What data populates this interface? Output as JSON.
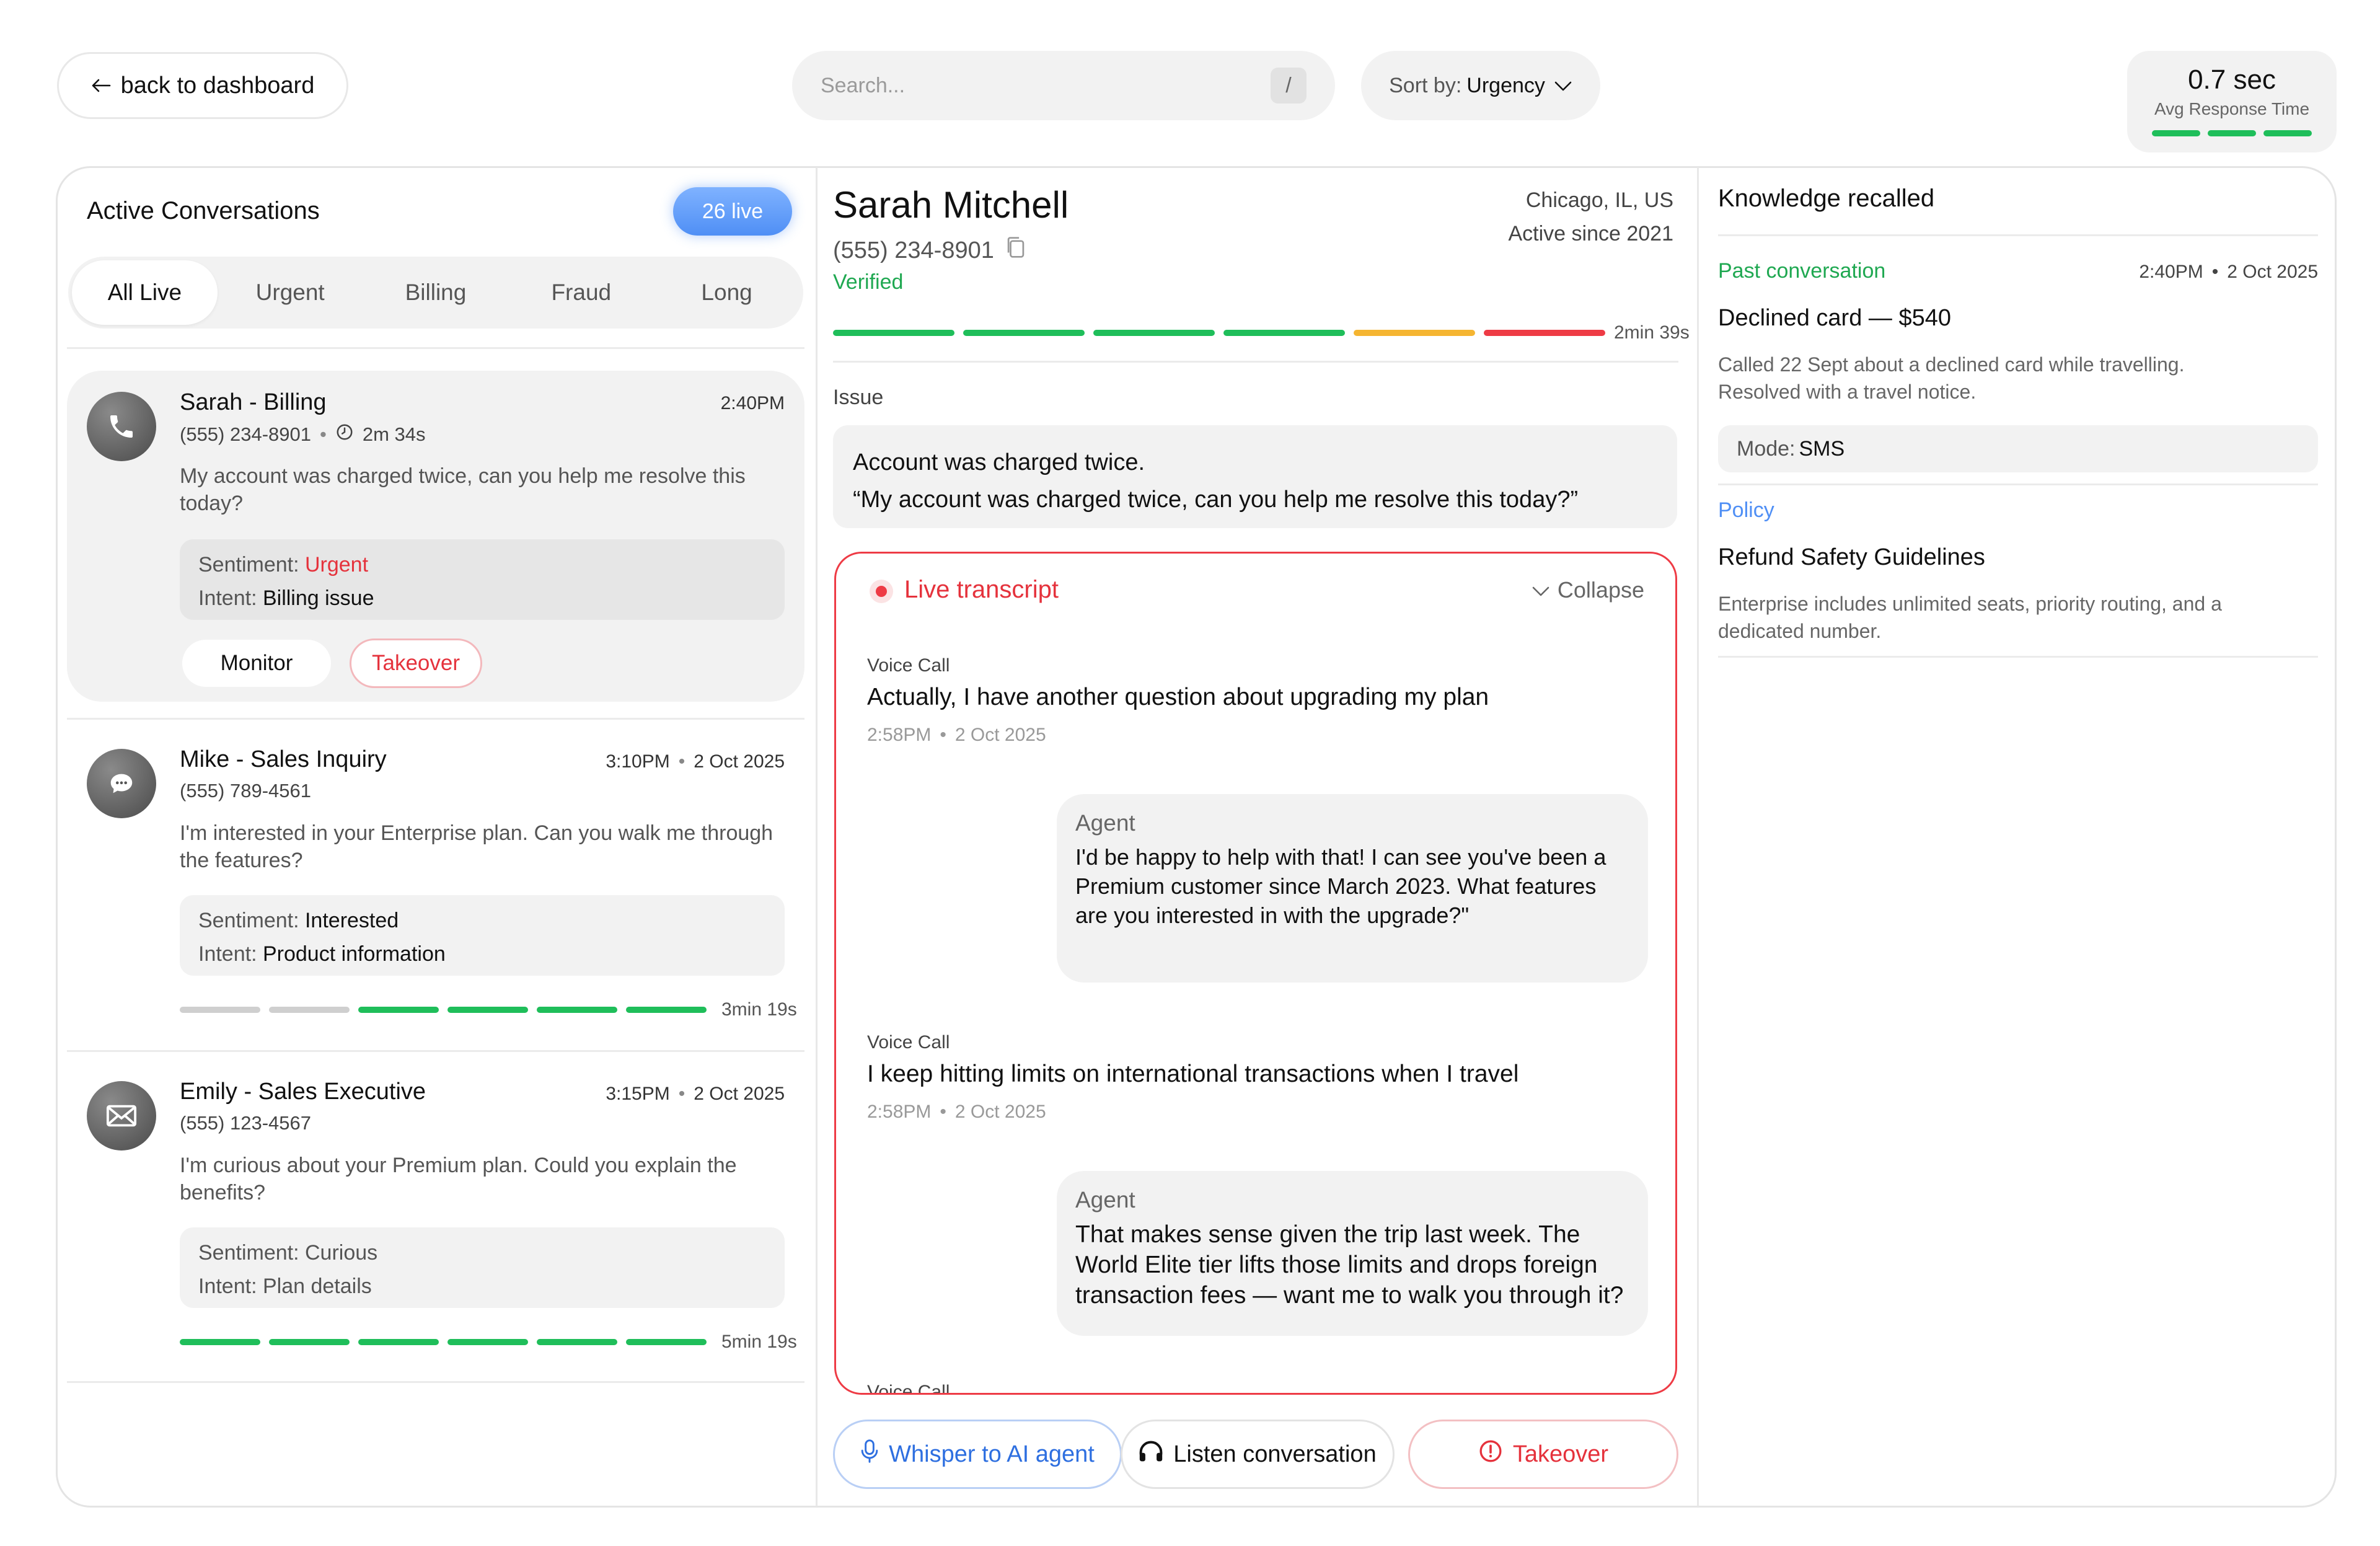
{
  "topbar": {
    "back_label": "back to dashboard",
    "search_placeholder": "Search...",
    "search_shortcut": "/",
    "sort_prefix": "Sort by:",
    "sort_value": "Urgency",
    "avg_response_value": "0.7 sec",
    "avg_response_label": "Avg Response Time"
  },
  "conversations": {
    "title": "Active Conversations",
    "live_count": "26 live",
    "tabs": [
      "All Live",
      "Urgent",
      "Billing",
      "Fraud",
      "Long"
    ],
    "active_tab": "All Live",
    "items": [
      {
        "name": "Sarah - Billing",
        "time": "2:40PM",
        "phone": "(555) 234-8901",
        "duration": "2m 34s",
        "message": "My account was charged twice, can you help me resolve this today?",
        "sentiment_label": "Sentiment:",
        "sentiment": "Urgent",
        "intent_label": "Intent:",
        "intent": "Billing issue",
        "monitor_label": "Monitor",
        "takeover_label": "Takeover",
        "channel_icon": "phone-icon"
      },
      {
        "name": "Mike - Sales Inquiry",
        "time": "3:10PM",
        "date": "2 Oct 2025",
        "phone": "(555) 789-4561",
        "message": "I'm interested in your Enterprise plan. Can you walk me through the features?",
        "sentiment_label": "Sentiment:",
        "sentiment": "Interested",
        "intent_label": "Intent:",
        "intent": "Product information",
        "elapsed": "3min 19s",
        "progress_segments": [
          "gray",
          "gray",
          "green",
          "green",
          "green",
          "green"
        ],
        "channel_icon": "chat-icon"
      },
      {
        "name": "Emily - Sales Executive",
        "time": "3:15PM",
        "date": "2 Oct 2025",
        "phone": "(555) 123-4567",
        "message": "I'm curious about your Premium plan. Could you explain the benefits?",
        "sentiment_label": "Sentiment:",
        "sentiment": "Curious",
        "intent_label": "Intent:",
        "intent": "Plan details",
        "elapsed": "5min 19s",
        "progress_segments": [
          "green",
          "green",
          "green",
          "green",
          "green",
          "green"
        ],
        "channel_icon": "mail-icon"
      }
    ]
  },
  "detail": {
    "name": "Sarah Mitchell",
    "phone": "(555) 234-8901",
    "verified": "Verified",
    "location": "Chicago, IL, US",
    "active_since": "Active since 2021",
    "elapsed": "2min 39s",
    "progress_segments": [
      "green",
      "green",
      "green",
      "green",
      "yellow",
      "red"
    ],
    "issue_label": "Issue",
    "issue_summary": "Account was charged twice.",
    "issue_quote": "“My account was charged twice, can you help me resolve this today?”",
    "transcript": {
      "title": "Live transcript",
      "collapse_label": "Collapse",
      "entries": [
        {
          "channel": "Voice Call",
          "message": "Actually, I have another question about upgrading my plan",
          "time": "2:58PM",
          "date": "2 Oct 2025"
        },
        {
          "agent_label": "Agent",
          "agent_text": "I'd be happy to help with that! I can see you've been a Premium customer since March 2023. What features are you interested in with the upgrade?\""
        },
        {
          "channel": "Voice Call",
          "message": "I keep hitting limits on international transactions when I travel",
          "time": "2:58PM",
          "date": "2 Oct 2025"
        },
        {
          "agent_label": "Agent",
          "agent_text": "That makes sense given the trip last week. The World Elite tier lifts those limits and drops foreign transaction fees — want me to walk you through it?"
        },
        {
          "channel": "Voice Call"
        }
      ]
    },
    "actions": {
      "whisper": "Whisper to AI agent",
      "listen": "Listen conversation",
      "takeover": "Takeover"
    }
  },
  "knowledge": {
    "title": "Knowledge recalled",
    "past": {
      "label": "Past conversation",
      "time": "2:40PM",
      "date": "2 Oct 2025",
      "heading": "Declined card — $540",
      "body": "Called 22 Sept about a declined card while travelling. Resolved with a travel notice.",
      "mode_label": "Mode:",
      "mode_value": "SMS"
    },
    "policy": {
      "label": "Policy",
      "heading": "Refund Safety Guidelines",
      "body": "Enterprise includes unlimited seats, priority routing, and a dedicated number."
    }
  },
  "colors": {
    "accent_blue": "#2e6fe0",
    "urgent_red": "#e5323c",
    "verified_green": "#1fa851",
    "progress_green": "#1fbe5a",
    "progress_yellow": "#f5b531",
    "progress_red": "#ee3b45",
    "progress_gray": "#cfcfcf"
  }
}
